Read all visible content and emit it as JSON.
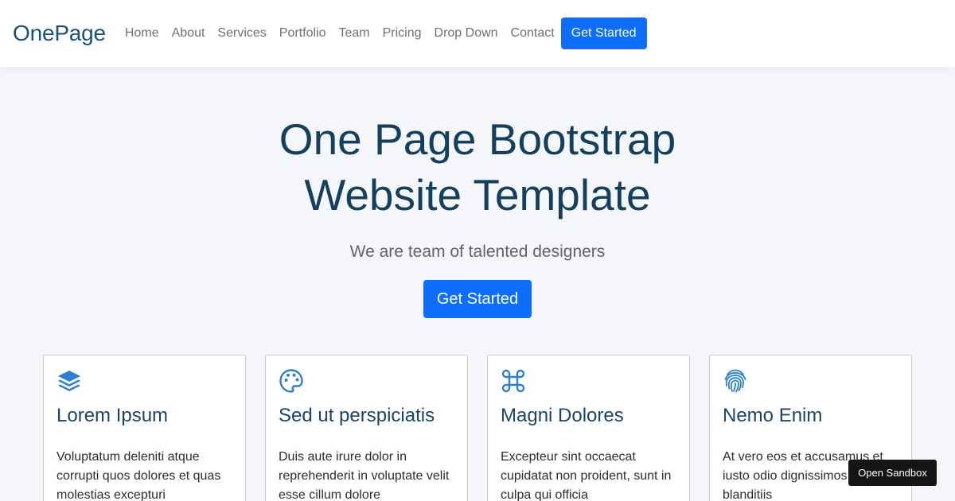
{
  "navbar": {
    "brand": "OnePage",
    "links": [
      "Home",
      "About",
      "Services",
      "Portfolio",
      "Team",
      "Pricing",
      "Drop Down",
      "Contact"
    ],
    "cta_label": "Get Started"
  },
  "hero": {
    "title_line1": "One Page Bootstrap",
    "title_line2": "Website Template",
    "subtitle": "We are team of talented designers",
    "cta_label": "Get Started"
  },
  "cards": [
    {
      "icon": "stack-layers-icon",
      "title": "Lorem Ipsum",
      "text": "Voluptatum deleniti atque corrupti quos dolores et quas molestias excepturi"
    },
    {
      "icon": "palette-icon",
      "title": "Sed ut perspiciatis",
      "text": "Duis aute irure dolor in reprehenderit in voluptate velit esse cillum dolore"
    },
    {
      "icon": "command-icon",
      "title": "Magni Dolores",
      "text": "Excepteur sint occaecat cupidatat non proident, sunt in culpa qui officia"
    },
    {
      "icon": "fingerprint-icon",
      "title": "Nemo Enim",
      "text": "At vero eos et accusamus et iusto odio dignissimos qui blanditiis"
    }
  ],
  "sandbox": {
    "label": "Open Sandbox"
  },
  "colors": {
    "accent": "#0d6efd",
    "brand": "#1a4f86",
    "icon": "#2b7fd4",
    "heading": "#14405f"
  }
}
